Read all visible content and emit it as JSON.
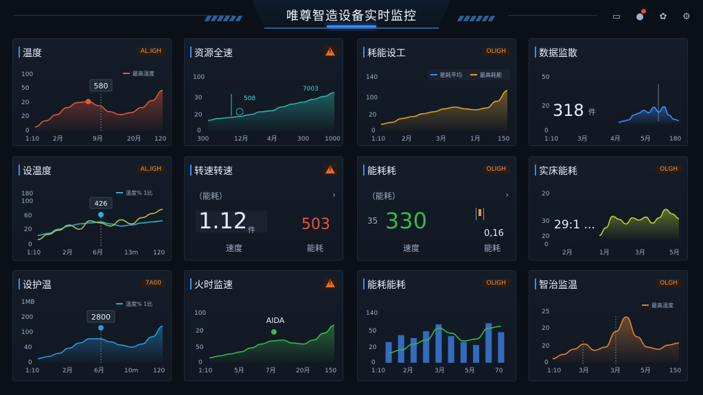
{
  "header": {
    "title": "唯尊智造设备实时监控",
    "icons": [
      "monitor-icon",
      "notification-icon",
      "settings-icon",
      "gear-icon"
    ],
    "accent": "#3a8cff"
  },
  "cards": [
    {
      "title": "温度",
      "badge": "AL.IGH",
      "callout": "580",
      "yticks": [
        "100",
        "50",
        "20",
        "20",
        "0"
      ],
      "xticks": [
        "1:10",
        "2月",
        "9月",
        "20月",
        "120"
      ],
      "legend": [
        {
          "label": "最高温度",
          "color": "#e0583a"
        }
      ]
    },
    {
      "title": "资源全速",
      "warn": true,
      "callout1": "508",
      "callout2": "7003",
      "yticks": [
        "100",
        "30",
        "20",
        "0"
      ],
      "xticks": [
        "300",
        "12月",
        "4月",
        "300",
        "1000"
      ]
    },
    {
      "title": "耗能设工",
      "badge": "OLIGH",
      "yticks": [
        "140",
        "100",
        "20",
        "0"
      ],
      "xticks": [
        "1:10",
        "2月",
        "3月",
        "1月",
        "150"
      ],
      "legend": [
        {
          "label": "能耗平均",
          "color": "#3a8cff"
        },
        {
          "label": "最高耗能",
          "color": "#e0a030"
        }
      ]
    },
    {
      "title": "数据监散",
      "bignum": "318",
      "unit": "件",
      "yticks": [
        "50",
        "20",
        "0"
      ],
      "xticks": [
        "1:10",
        "3月",
        "4月",
        "5月",
        "180"
      ]
    },
    {
      "title": "设温度",
      "badge": "AL.IGH",
      "callout": "426",
      "yticks": [
        "180",
        "100",
        "60",
        "20",
        "0"
      ],
      "xticks": [
        "1:10",
        "2月",
        "6月",
        "13m",
        "120"
      ],
      "legend": [
        {
          "label": "温度% 1比",
          "color": "#2ab0d8"
        }
      ]
    },
    {
      "title": "转速转速",
      "warn": true,
      "sub": "能耗",
      "bignum": "1.12",
      "unit": "件",
      "rnum": "503",
      "lbl1": "速度",
      "lbl2": "能耗"
    },
    {
      "title": "能耗耗",
      "badge": "OLIGH",
      "sub": "能耗",
      "ytick": "35",
      "bignum": "330",
      "lbl1": "速度",
      "rval": "0,16",
      "lbl2": "能耗"
    },
    {
      "title": "实床能耗",
      "badge": "OLGH",
      "bignum": "29:1 ...",
      "yticks": [
        "20",
        "30",
        "20",
        "0"
      ],
      "xticks": [
        "2月",
        "1月",
        "3月",
        "5月"
      ]
    },
    {
      "title": "设护温",
      "badge": "7A00",
      "callout": "2800",
      "yticks": [
        "1MB",
        "200",
        "100",
        "40",
        "0"
      ],
      "xticks": [
        "1:10",
        "2月",
        "6月",
        "10m",
        "120"
      ],
      "legend": [
        {
          "label": "温度% 1比",
          "color": "#2ab0d8"
        }
      ]
    },
    {
      "title": "火时监速",
      "warn": true,
      "callout": "AIDA",
      "yticks": [
        "100",
        "20",
        "50",
        "0"
      ],
      "xticks": [
        "1:10",
        "5月",
        "7月",
        "20月",
        "150"
      ]
    },
    {
      "title": "能耗能耗",
      "badge": "OLIGH",
      "yticks": [
        "140",
        "50",
        "20",
        "0"
      ],
      "xticks": [
        "1:10",
        "2月",
        "3月",
        "5月",
        "70"
      ]
    },
    {
      "title": "智治监温",
      "badge": "OLGH",
      "yticks": [
        "25",
        "20",
        "20",
        "0"
      ],
      "xticks": [
        "1:10",
        "3月",
        "3月",
        "5月",
        "150"
      ],
      "legend": [
        {
          "label": "最高温度",
          "color": "#e0843a"
        }
      ]
    }
  ],
  "chart_data": [
    {
      "type": "area",
      "title": "温度",
      "color": "#e0583a",
      "ylim": [
        0,
        100
      ],
      "x": [
        0,
        1,
        2,
        3,
        4,
        5,
        6,
        7,
        8,
        9,
        10,
        11,
        12
      ],
      "values": [
        8,
        20,
        32,
        46,
        56,
        58,
        50,
        38,
        32,
        36,
        46,
        60,
        80
      ]
    },
    {
      "type": "area",
      "title": "资源全速",
      "color": "#2ab0a8",
      "ylim": [
        0,
        100
      ],
      "x": [
        0,
        1,
        2,
        3,
        4,
        5,
        6,
        7,
        8,
        9,
        10,
        11,
        12
      ],
      "values": [
        22,
        26,
        28,
        30,
        34,
        40,
        42,
        50,
        56,
        60,
        66,
        72,
        80
      ]
    },
    {
      "type": "area",
      "title": "耗能设工",
      "color": "#e0a030",
      "ylim": [
        0,
        100
      ],
      "x": [
        0,
        1,
        2,
        3,
        4,
        5,
        6,
        7,
        8,
        9,
        10,
        11,
        12
      ],
      "values": [
        14,
        18,
        26,
        30,
        36,
        40,
        46,
        50,
        46,
        44,
        48,
        62,
        84
      ]
    },
    {
      "type": "area",
      "title": "数据监散",
      "color": "#3a8cff",
      "ylim": [
        0,
        100
      ],
      "x": [
        0,
        1,
        2,
        3,
        4,
        5,
        6,
        7,
        8,
        9,
        10,
        11,
        12
      ],
      "values": [
        6,
        10,
        14,
        30,
        36,
        46,
        38,
        56,
        40,
        58,
        30,
        16,
        12
      ]
    },
    {
      "type": "line",
      "title": "设温度",
      "ylim": [
        0,
        100
      ],
      "series": [
        {
          "color": "#2ab0d8",
          "values": [
            18,
            22,
            30,
            36,
            40,
            42,
            44,
            40,
            36,
            38,
            42,
            44,
            46
          ]
        },
        {
          "color": "#b8c040",
          "values": [
            10,
            20,
            28,
            38,
            30,
            46,
            42,
            36,
            48,
            40,
            52,
            60,
            68
          ]
        }
      ]
    },
    {
      "type": "area",
      "title": "实床能耗",
      "color": "#b8d030",
      "ylim": [
        0,
        100
      ],
      "x": [
        0,
        1,
        2,
        3,
        4,
        5,
        6,
        7,
        8,
        9,
        10,
        11,
        12
      ],
      "values": [
        10,
        30,
        60,
        52,
        40,
        56,
        50,
        58,
        42,
        56,
        78,
        66,
        54
      ]
    },
    {
      "type": "area",
      "title": "设护温",
      "color": "#2a9ae0",
      "ylim": [
        0,
        100
      ],
      "x": [
        0,
        1,
        2,
        3,
        4,
        5,
        6,
        7,
        8,
        9,
        10,
        11,
        12
      ],
      "values": [
        8,
        12,
        18,
        28,
        38,
        46,
        46,
        40,
        34,
        30,
        36,
        50,
        70
      ]
    },
    {
      "type": "area",
      "title": "火时监速",
      "color": "#3ab84a",
      "ylim": [
        0,
        100
      ],
      "x": [
        0,
        1,
        2,
        3,
        4,
        5,
        6,
        7,
        8,
        9,
        10,
        11,
        12
      ],
      "values": [
        10,
        14,
        18,
        22,
        30,
        38,
        44,
        46,
        40,
        38,
        46,
        60,
        76
      ]
    },
    {
      "type": "bar",
      "title": "能耗能耗",
      "color": "#3a7ad8",
      "ylim": [
        0,
        100
      ],
      "categories": [
        "1",
        "2",
        "3",
        "4",
        "5",
        "6",
        "7",
        "8",
        "9",
        "10"
      ],
      "values": [
        42,
        56,
        50,
        64,
        78,
        54,
        42,
        36,
        80,
        62
      ],
      "line": [
        20,
        26,
        38,
        46,
        70,
        60,
        44,
        48,
        70,
        74
      ]
    },
    {
      "type": "area",
      "title": "智治监温",
      "color": "#e0843a",
      "ylim": [
        0,
        100
      ],
      "x": [
        0,
        1,
        2,
        3,
        4,
        5,
        6,
        7,
        8,
        9,
        10,
        11,
        12
      ],
      "values": [
        8,
        16,
        26,
        36,
        24,
        30,
        60,
        88,
        50,
        30,
        26,
        34,
        38
      ]
    }
  ]
}
